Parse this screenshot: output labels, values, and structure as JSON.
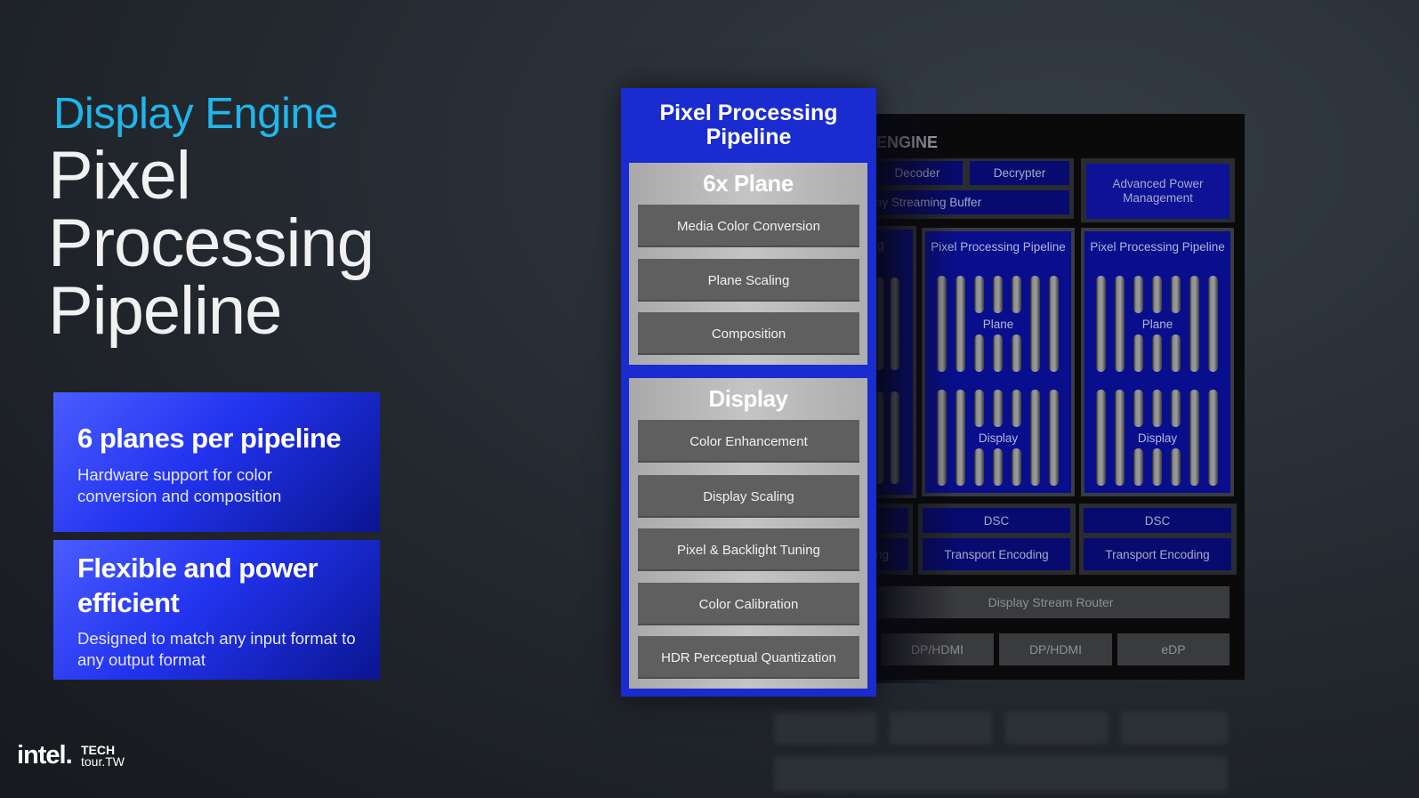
{
  "slide": {
    "kicker": "Display Engine",
    "title_lines": [
      "Pixel",
      "Processing",
      "Pipeline"
    ]
  },
  "cards": [
    {
      "heading": "6 planes per pipeline",
      "body": "Hardware support for color conversion and composition"
    },
    {
      "heading": "Flexible and power efficient",
      "body": "Designed to match any input format to any output format"
    }
  ],
  "footer": {
    "intel_logo": "intel.",
    "techtour_line1": "TECH",
    "techtour_line2": "tour.TW"
  },
  "pipeline_card": {
    "title": "Pixel Processing Pipeline",
    "plane_section": {
      "heading": "6x Plane",
      "stages": [
        "Media Color Conversion",
        "Plane Scaling",
        "Composition"
      ]
    },
    "display_section": {
      "heading": "Display",
      "stages": [
        "Color Enhancement",
        "Display Scaling",
        "Pixel & Backlight Tuning",
        "Color Calibration",
        "HDR Perceptual Quantization"
      ]
    }
  },
  "engine_diagram": {
    "label": "ENGINE",
    "decoder": "Decoder",
    "decrypter": "Decrypter",
    "streaming_buffer": "ay Streaming Buffer",
    "power_mgmt": "Advanced Power Management",
    "partial_pipeline_title": "g",
    "pipelines": [
      {
        "title": "Pixel Processing Pipeline",
        "plane_label": "Plane",
        "display_label": "Display",
        "dsc": "DSC",
        "transport": "Transport Encoding"
      },
      {
        "title": "Pixel Processing Pipeline",
        "plane_label": "Plane",
        "display_label": "Display",
        "dsc": "DSC",
        "transport": "Transport Encoding"
      }
    ],
    "partial_transport": "ng",
    "router": "Display Stream Router",
    "ports": [
      "DP/HDMI",
      "DP/HDMI",
      "eDP"
    ]
  },
  "colors": {
    "kicker": "#1fb6ea",
    "card_blue": "#2233ee",
    "pipeline_blue": "#1a2bd0",
    "engine_blue": "#070a6e"
  }
}
